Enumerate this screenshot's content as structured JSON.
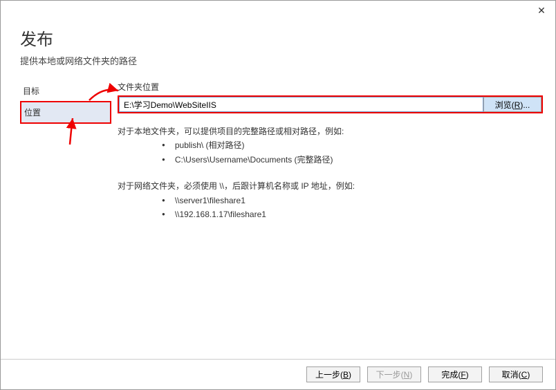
{
  "titlebar": {
    "close": "✕"
  },
  "header": {
    "title": "发布",
    "subtitle": "提供本地或网络文件夹的路径"
  },
  "sidebar": {
    "items": [
      {
        "label": "目标"
      },
      {
        "label": "位置"
      }
    ]
  },
  "main": {
    "folder_label": "文件夹位置",
    "folder_value": "E:\\学习Demo\\WebSiteIIS",
    "browse_label": "浏览(R)...",
    "help": {
      "local_intro": "对于本地文件夹，可以提供项目的完整路径或相对路径，例如:",
      "local_ex1": "publish\\ (相对路径)",
      "local_ex2": "C:\\Users\\Username\\Documents (完整路径)",
      "net_intro": "对于网络文件夹，必须使用 \\\\，后跟计算机名称或 IP 地址，例如:",
      "net_ex1": "\\\\server1\\fileshare1",
      "net_ex2": "\\\\192.168.1.17\\fileshare1"
    }
  },
  "footer": {
    "back": "上一步(B)",
    "next": "下一步(N)",
    "finish": "完成(F)",
    "cancel": "取消(C)"
  }
}
